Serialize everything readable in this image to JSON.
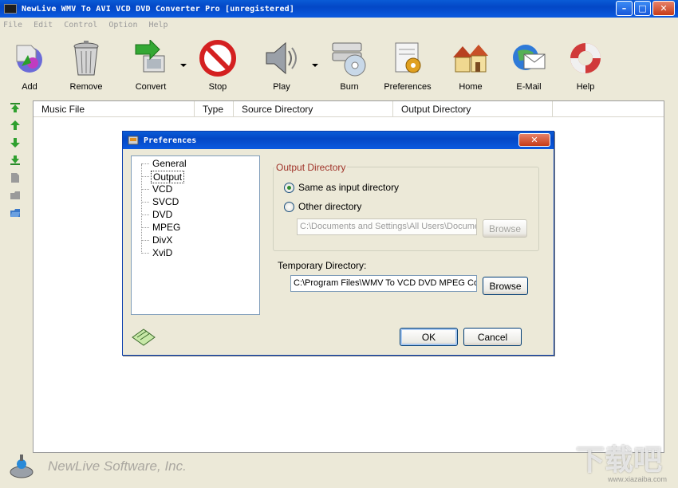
{
  "window": {
    "title": "NewLive WMV To AVI VCD DVD Converter Pro  [unregistered]",
    "minimize_glyph": "–",
    "maximize_glyph": "□",
    "close_glyph": "✕"
  },
  "menu": [
    "File",
    "Edit",
    "Control",
    "Option",
    "Help"
  ],
  "toolbar": {
    "add": "Add",
    "remove": "Remove",
    "convert": "Convert",
    "stop": "Stop",
    "play": "Play",
    "burn": "Burn",
    "preferences": "Preferences",
    "home": "Home",
    "email": "E-Mail",
    "help": "Help"
  },
  "list": {
    "columns": [
      "Music File",
      "Type",
      "Source Directory",
      "Output Directory"
    ]
  },
  "brand": "NewLive Software, Inc.",
  "watermark": "下载吧",
  "watermark_url": "www.xiazaiba.com",
  "dialog": {
    "title": "Preferences",
    "close_glyph": "✕",
    "tree": [
      "General",
      "Output",
      "VCD",
      "SVCD",
      "DVD",
      "MPEG",
      "DivX",
      "XviD"
    ],
    "selected_index": 1,
    "output_group_title": "Output Directory",
    "radio_same": "Same as input directory",
    "radio_other": "Other directory",
    "other_dir_value": "C:\\Documents and Settings\\All Users\\Docume",
    "browse_label": "Browse",
    "temp_label": "Temporary Directory:",
    "temp_value": "C:\\Program Files\\WMV To VCD DVD MPEG Co",
    "ok_label": "OK",
    "cancel_label": "Cancel"
  }
}
